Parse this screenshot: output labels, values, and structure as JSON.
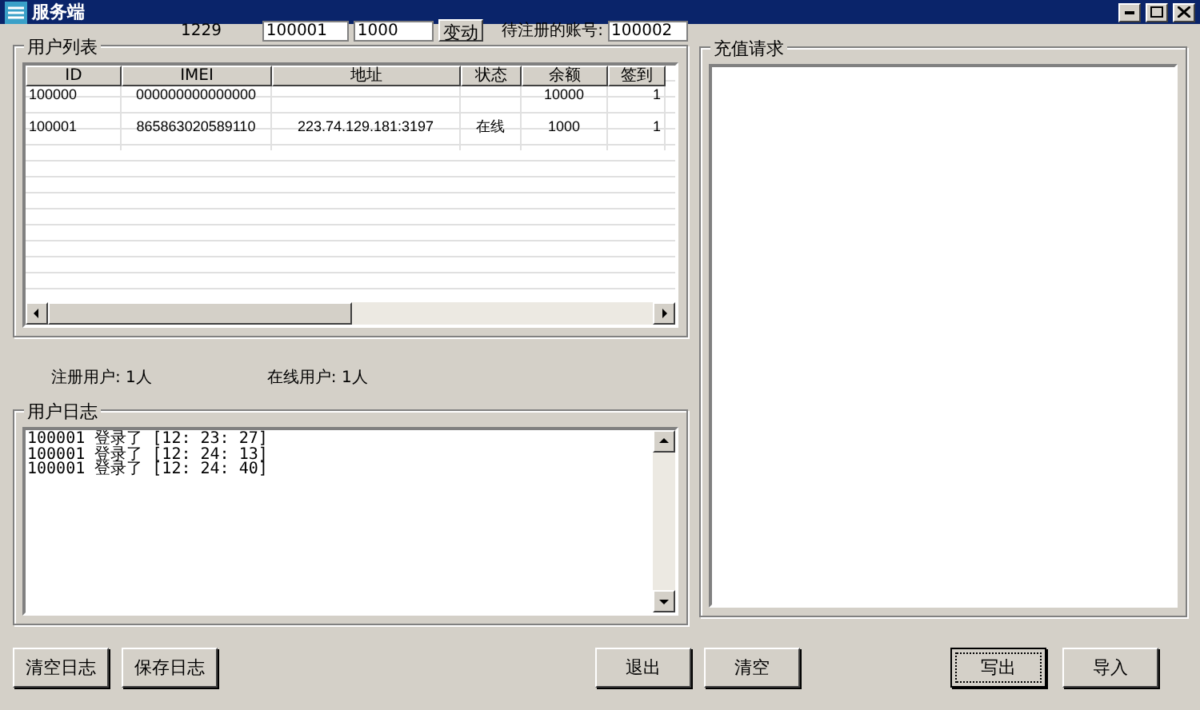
{
  "window": {
    "title": "服务端"
  },
  "top_bar": {
    "code": "1229",
    "id_value": "100001",
    "amount_value": "1000",
    "change_button": "变动",
    "pending_label": "待注册的账号:",
    "pending_value": "100002"
  },
  "user_list": {
    "title": "用户列表",
    "columns": [
      "ID",
      "IMEI",
      "地址",
      "状态",
      "余额",
      "签到"
    ],
    "rows": [
      {
        "cells": [
          "100000",
          "000000000000000",
          "",
          "",
          "10000",
          "1"
        ]
      },
      {
        "cells": [
          "100001",
          "865863020589110",
          "223.74.129.181:3197",
          "在线",
          "1000",
          "1"
        ]
      }
    ]
  },
  "stats": [
    "注册用户: 1人",
    "在线用户: 1人"
  ],
  "log": {
    "title": "用户日志",
    "lines": [
      "100001 登录了 [12: 23: 27]",
      "100001 登录了 [12: 24: 13]",
      "100001 登录了 [12: 24: 40]"
    ]
  },
  "recharge": {
    "title": "充值请求"
  },
  "button_groups": [
    [
      {
        "label": "清空日志",
        "focused": false
      },
      {
        "label": "保存日志",
        "focused": false
      }
    ],
    [
      {
        "label": "退出",
        "focused": false
      },
      {
        "label": "清空",
        "focused": false
      }
    ],
    [
      {
        "label": "写出",
        "focused": true
      },
      {
        "label": "导入",
        "focused": false
      }
    ]
  ]
}
